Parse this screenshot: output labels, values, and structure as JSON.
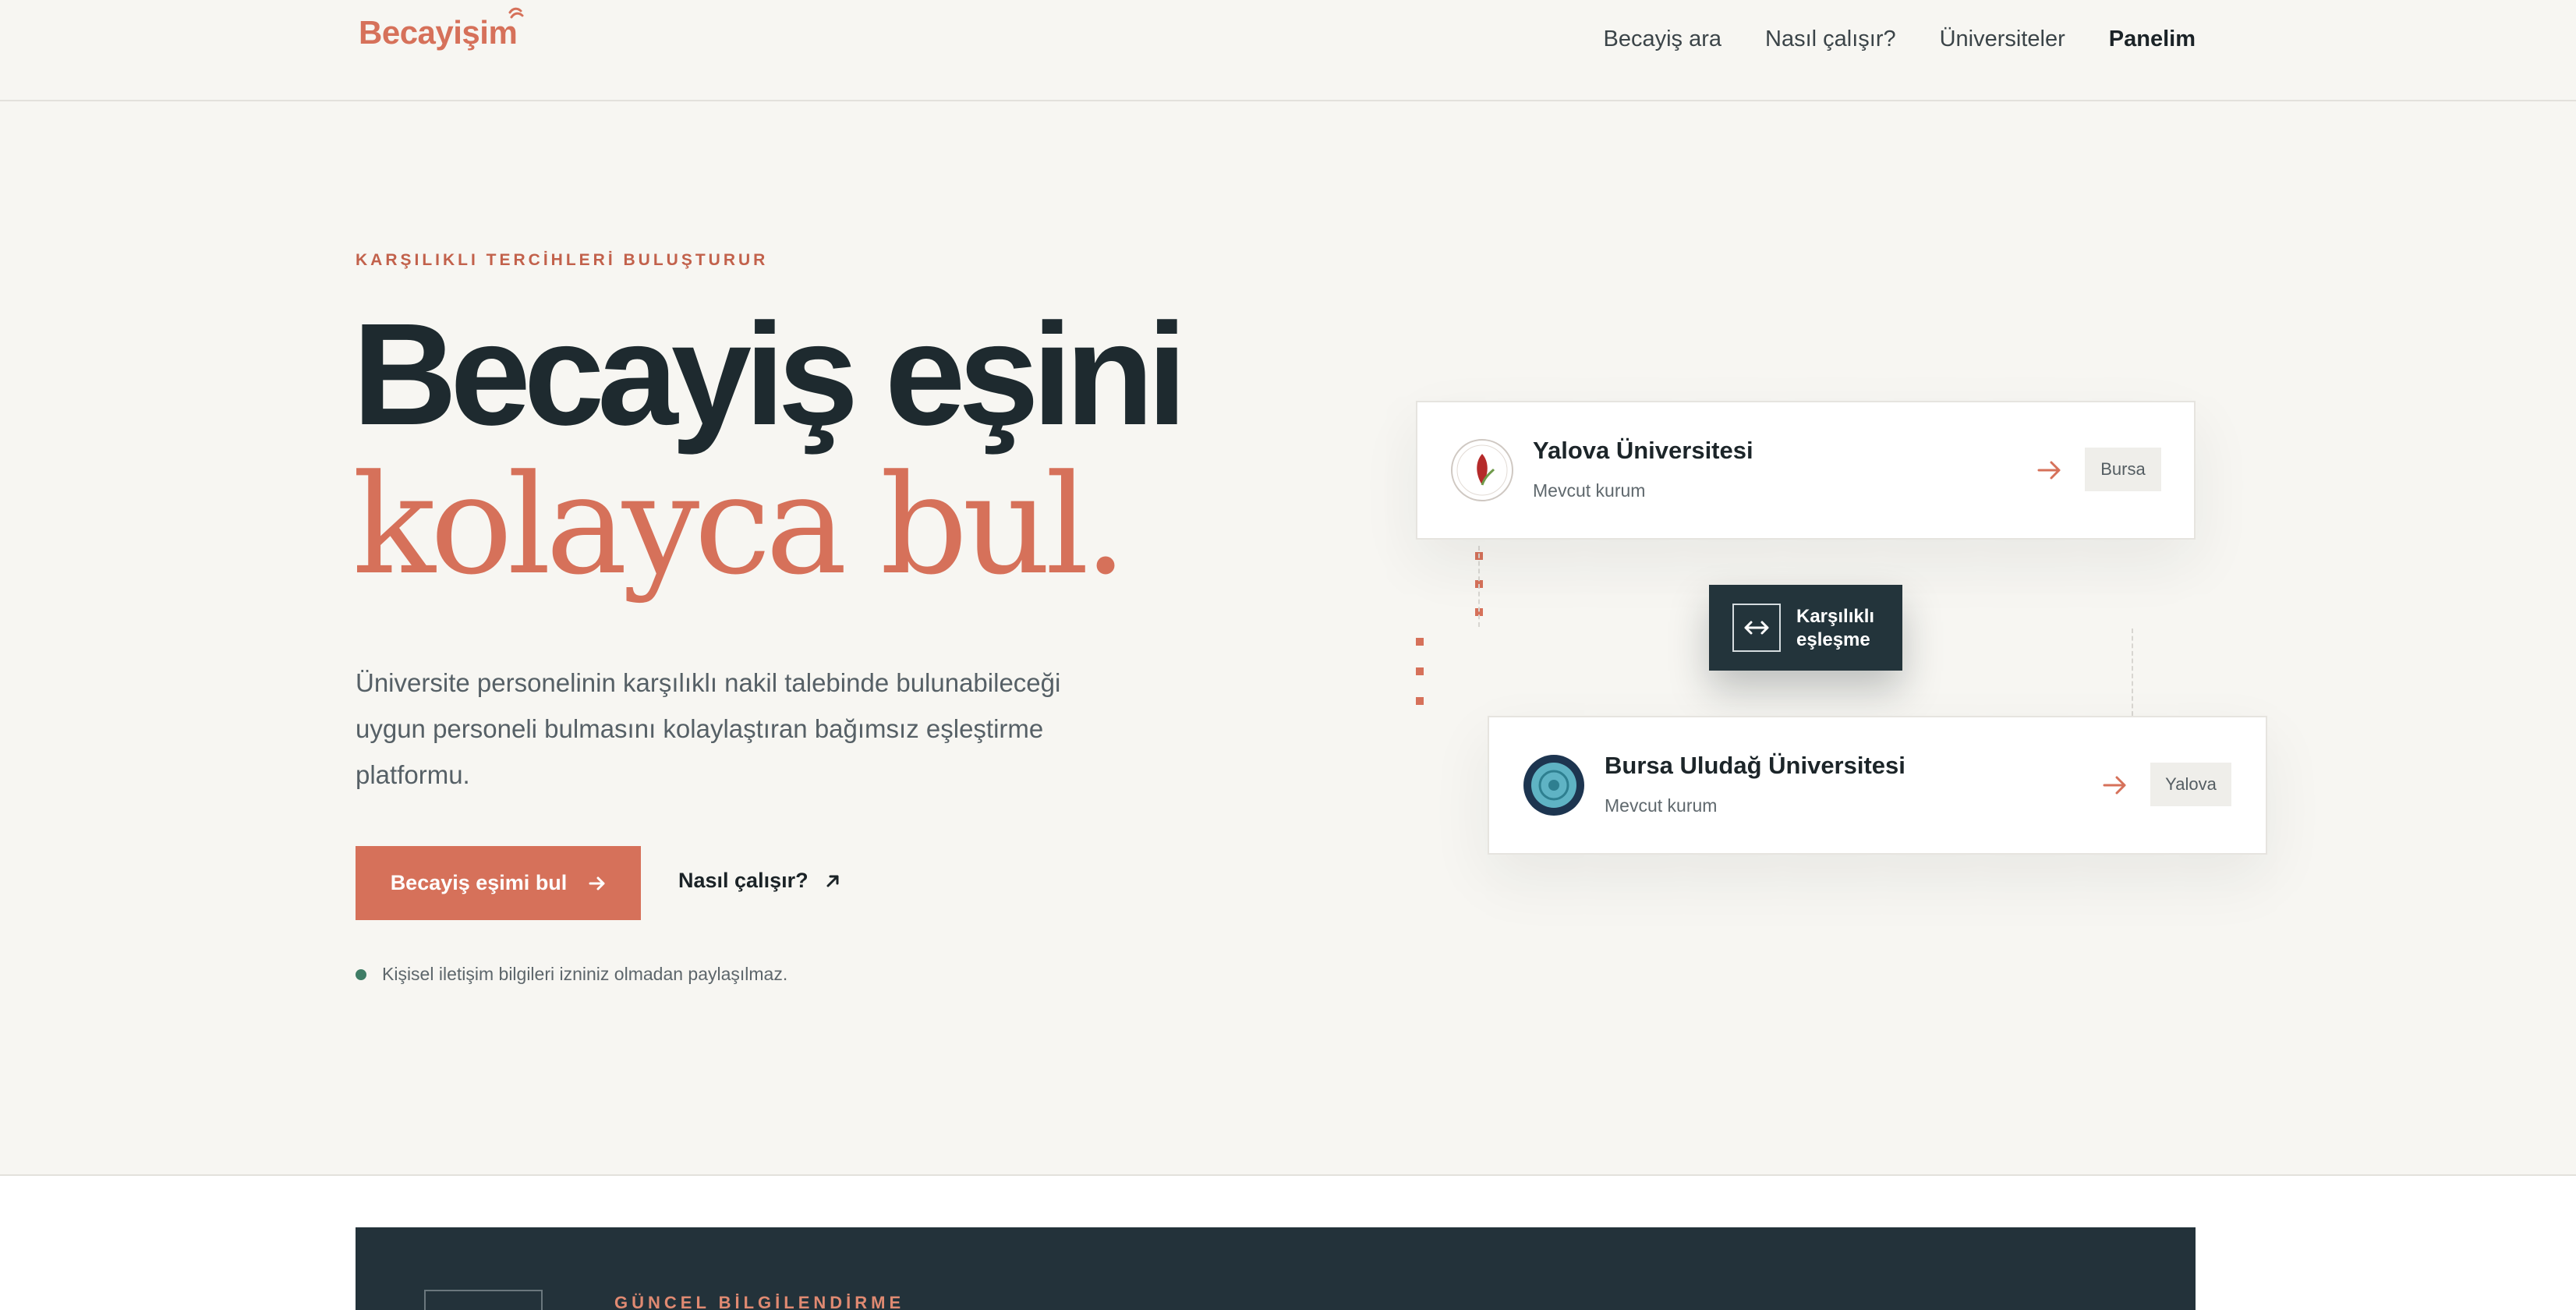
{
  "header": {
    "logo": "Becayişim",
    "nav": [
      {
        "label": "Becayiş ara"
      },
      {
        "label": "Nasıl çalışır?"
      },
      {
        "label": "Üniversiteler"
      },
      {
        "label": "Panelim"
      }
    ]
  },
  "hero": {
    "eyebrow": "KARŞILIKLI TERCİHLERİ BULUŞTURUR",
    "headline_line1": "Becayiş eşini",
    "headline_line2": "kolayca bul.",
    "lead": "Üniversite personelinin karşılıklı nakil talebinde bulunabileceği uygun personeli bulmasını kolaylaştıran bağımsız eşleştirme platformu.",
    "cta_label": "Becayiş eşimi bul",
    "secondary_label": "Nasıl çalışır?",
    "privacy_note": "Kişisel iletişim bilgileri izniniz olmadan paylaşılmaz."
  },
  "match": {
    "card1": {
      "name": "Yalova Üniversitesi",
      "sub": "Mevcut kurum",
      "dest": "Bursa"
    },
    "card2": {
      "name": "Bursa Uludağ Üniversitesi",
      "sub": "Mevcut kurum",
      "dest": "Yalova"
    },
    "badge_line1": "Karşılıklı",
    "badge_line2": "eşleşme"
  },
  "lower": {
    "label": "GÜNCEL BİLGİLENDİRME"
  },
  "colors": {
    "accent": "#d6715a",
    "dark": "#23343b",
    "background": "#f7f6f2",
    "status": "#3f7d66"
  },
  "icons": [
    "logo-swirl-icon",
    "arrow-right-icon",
    "arrow-up-right-icon",
    "swap-icon",
    "university-seal-icon"
  ]
}
